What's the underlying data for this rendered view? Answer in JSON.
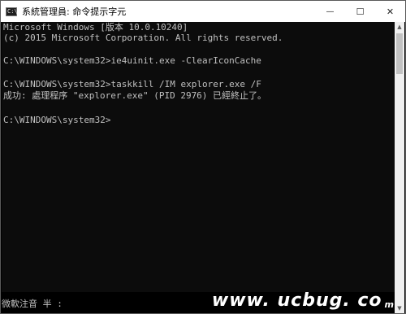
{
  "window": {
    "title": "系統管理員: 命令提示字元",
    "icon": "cmd-icon",
    "icon_glyph": "C:\\",
    "controls": {
      "minimize": "—",
      "maximize": "☐",
      "close": "✕"
    }
  },
  "console": {
    "lines": [
      "Microsoft Windows [版本 10.0.10240]",
      "(c) 2015 Microsoft Corporation. All rights reserved.",
      "",
      "C:\\WINDOWS\\system32>ie4uinit.exe -ClearIconCache",
      "",
      "C:\\WINDOWS\\system32>taskkill /IM explorer.exe /F",
      "成功: 處理程序 \"explorer.exe\" (PID 2976) 已經終止了。",
      "",
      "C:\\WINDOWS\\system32>"
    ],
    "text_color": "#c0c0c0",
    "background": "#0c0c0c"
  },
  "ime_status": "微軟注音 半 :",
  "watermark": {
    "main": "www. ucbug. co",
    "sub": "m"
  }
}
